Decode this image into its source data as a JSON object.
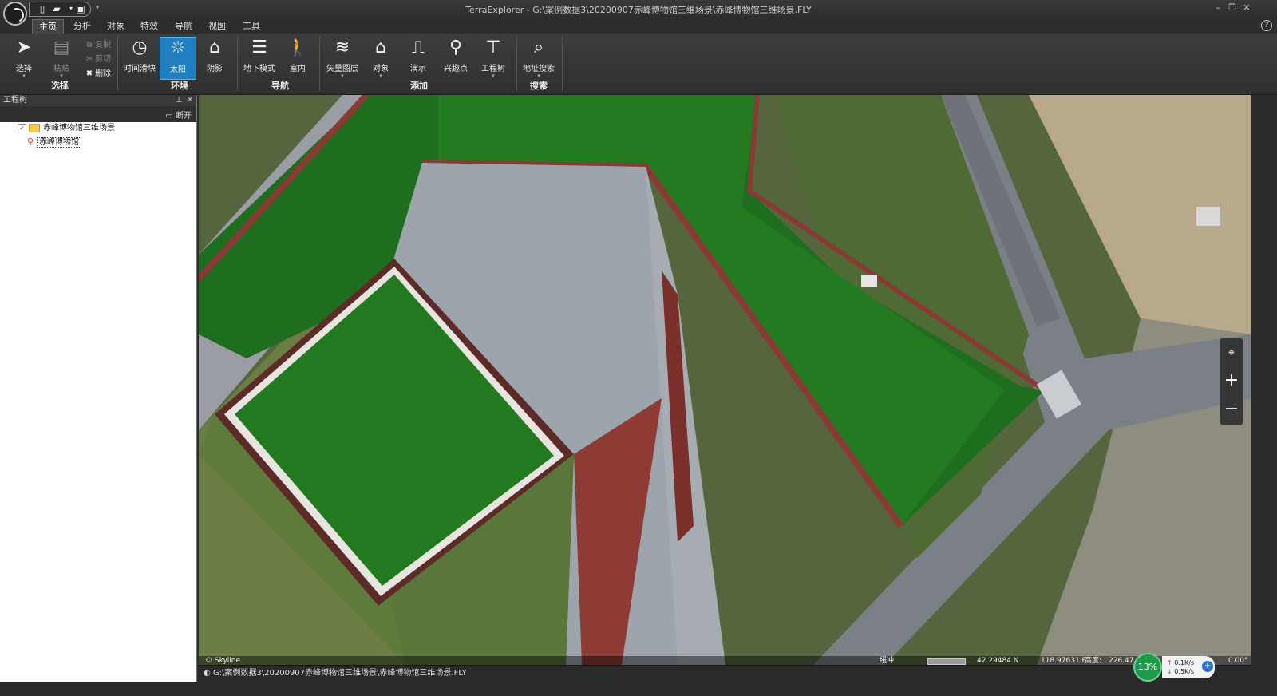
{
  "window": {
    "title": "TerraExplorer - G:\\案例数据3\\20200907赤峰博物馆三维场景\\赤峰博物馆三维场景.FLY",
    "controls": {
      "minimize": "–",
      "restore": "❐",
      "close": "✕"
    }
  },
  "quick_access": [
    {
      "name": "new-file-icon",
      "glyph": "🗋"
    },
    {
      "name": "open-folder-icon",
      "glyph": "📂"
    },
    {
      "name": "save-icon",
      "glyph": "💾"
    }
  ],
  "menu": {
    "tabs": [
      "主页",
      "分析",
      "对象",
      "特效",
      "导航",
      "视图",
      "工具"
    ],
    "active": "主页"
  },
  "ribbon": {
    "groups": {
      "select": "选择",
      "environment": "环境",
      "navigation": "导航",
      "add": "添加",
      "search": "搜索"
    },
    "buttons": {
      "select": "选择",
      "paste": "粘贴",
      "copy": "复制",
      "cut": "剪切",
      "delete": "删除",
      "time_slider": "时间滑块",
      "sun": "太阳",
      "shadow": "阴影",
      "underground": "地下模式",
      "indoor": "室内",
      "vector_layer": "矢量图层",
      "object": "对象",
      "presentation": "演示",
      "poi": "兴趣点",
      "project_tree": "工程树",
      "address_search": "地址搜索"
    }
  },
  "panel": {
    "title": "工程树",
    "disconnect": "断开",
    "tree": [
      {
        "label": "赤峰博物馆三维场景",
        "checked": true,
        "type": "folder"
      },
      {
        "label": "赤峰博物馆",
        "type": "location"
      }
    ]
  },
  "view": {
    "credit": "© Skyline",
    "buffer_label": "缓冲",
    "latitude": "42.29484 N",
    "longitude": "118.97631 E",
    "altitude_label": "高度:",
    "altitude_value": "226.47",
    "heading": "0.00°"
  },
  "status": {
    "path": "G:\\案例数据3\\20200907赤峰博物馆三维场景\\赤峰博物馆三维场景.FLY",
    "network_percent": "13%",
    "upload": "0.1K/s",
    "download": "0.5K/s"
  }
}
